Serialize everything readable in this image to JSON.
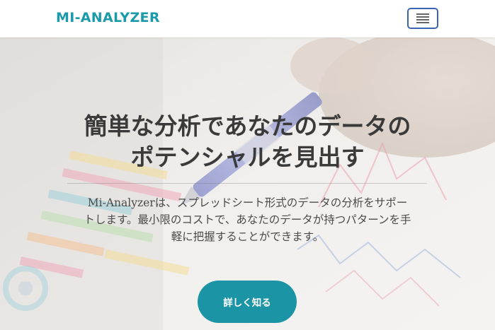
{
  "navbar": {
    "brand": "MI-ANALYZER",
    "menu_icon": "hamburger-menu-icon"
  },
  "hero": {
    "headline_lines": [
      "簡単な分析であなたのデータの",
      "ポテンシャルを見出す"
    ],
    "lead_lines": [
      "Mi-Analyzerは、スプレッドシート形式のデータの分析をサポー",
      "トします。最小限のコストで、あなたのデータが持つパターンを手",
      "軽に把握することができます。"
    ],
    "cta_label": "詳しく知る",
    "background_image": "pen-over-printed-charts-photo"
  },
  "colors": {
    "brand": "#1b9aaa",
    "toggler_border": "#3d64b4",
    "cta_background": "#1b95a5",
    "headline_text": "#3a3a3a",
    "body_text": "#4a4a4a"
  }
}
